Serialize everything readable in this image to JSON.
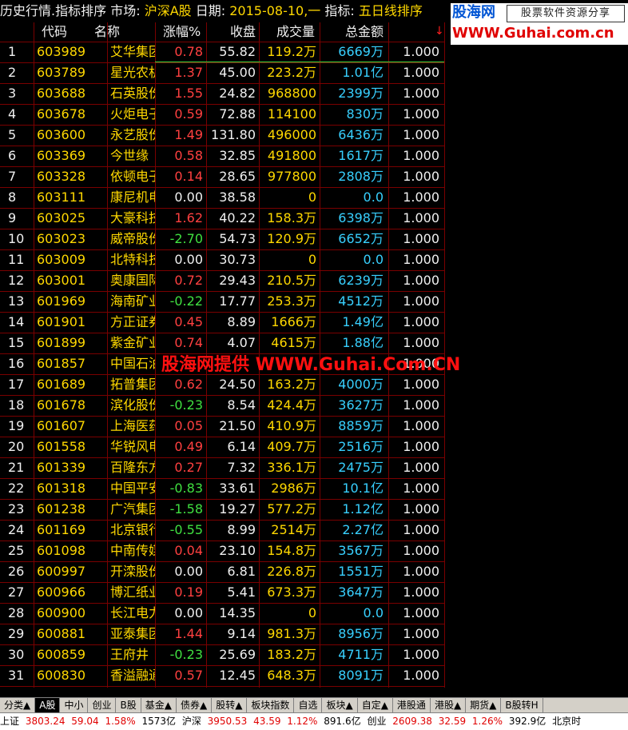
{
  "titlebar": {
    "part1": "历史行情.指标排序",
    "market_label": "市场:",
    "market_value": "沪深A股",
    "date_label": "日期:",
    "date_value": "2015-08-10,一",
    "indicator_label": "指标:",
    "indicator_value": "五日线排序"
  },
  "logo": {
    "brand": "股海网",
    "slogan": "股票软件资源分享",
    "url": "WWW.Guhai.com.cn"
  },
  "table": {
    "headers": [
      "代码",
      "名称",
      "涨幅%",
      "收盘",
      "成交量",
      "总金额"
    ],
    "sort_indicator": "↓",
    "rows": [
      {
        "idx": "1",
        "code": "603989",
        "name": "艾华集团",
        "chg": "0.78",
        "dir": "up",
        "close": "55.82",
        "vol": "119.2万",
        "amt": "6669万",
        "val": "1.000"
      },
      {
        "idx": "2",
        "code": "603789",
        "name": "星光农机",
        "chg": "1.37",
        "dir": "up",
        "close": "45.00",
        "vol": "223.2万",
        "amt": "1.01亿",
        "val": "1.000"
      },
      {
        "idx": "3",
        "code": "603688",
        "name": "石英股份",
        "chg": "1.55",
        "dir": "up",
        "close": "24.82",
        "vol": "968800",
        "amt": "2399万",
        "val": "1.000"
      },
      {
        "idx": "4",
        "code": "603678",
        "name": "火炬电子",
        "chg": "0.59",
        "dir": "up",
        "close": "72.88",
        "vol": "114100",
        "amt": "830万",
        "val": "1.000"
      },
      {
        "idx": "5",
        "code": "603600",
        "name": "永艺股份",
        "chg": "1.49",
        "dir": "up",
        "close": "131.80",
        "vol": "496000",
        "amt": "6436万",
        "val": "1.000"
      },
      {
        "idx": "6",
        "code": "603369",
        "name": "今世缘",
        "chg": "0.58",
        "dir": "up",
        "close": "32.85",
        "vol": "491800",
        "amt": "1617万",
        "val": "1.000"
      },
      {
        "idx": "7",
        "code": "603328",
        "name": "依顿电子",
        "chg": "0.14",
        "dir": "up",
        "close": "28.65",
        "vol": "977800",
        "amt": "2808万",
        "val": "1.000"
      },
      {
        "idx": "8",
        "code": "603111",
        "name": "康尼机电",
        "chg": "0.00",
        "dir": "flat",
        "close": "38.58",
        "vol": "0",
        "amt": "0.0",
        "val": "1.000"
      },
      {
        "idx": "9",
        "code": "603025",
        "name": "大豪科技",
        "chg": "1.62",
        "dir": "up",
        "close": "40.22",
        "vol": "158.3万",
        "amt": "6398万",
        "val": "1.000"
      },
      {
        "idx": "10",
        "code": "603023",
        "name": "威帝股份",
        "chg": "-2.70",
        "dir": "down",
        "close": "54.73",
        "vol": "120.9万",
        "amt": "6652万",
        "val": "1.000"
      },
      {
        "idx": "11",
        "code": "603009",
        "name": "北特科技",
        "chg": "0.00",
        "dir": "flat",
        "close": "30.73",
        "vol": "0",
        "amt": "0.0",
        "val": "1.000"
      },
      {
        "idx": "12",
        "code": "603001",
        "name": "奥康国际",
        "chg": "0.72",
        "dir": "up",
        "close": "29.43",
        "vol": "210.5万",
        "amt": "6239万",
        "val": "1.000"
      },
      {
        "idx": "13",
        "code": "601969",
        "name": "海南矿业",
        "chg": "-0.22",
        "dir": "down",
        "close": "17.77",
        "vol": "253.3万",
        "amt": "4512万",
        "val": "1.000"
      },
      {
        "idx": "14",
        "code": "601901",
        "name": "方正证券",
        "chg": "0.45",
        "dir": "up",
        "close": "8.89",
        "vol": "1666万",
        "amt": "1.49亿",
        "val": "1.000"
      },
      {
        "idx": "15",
        "code": "601899",
        "name": "紫金矿业",
        "chg": "0.74",
        "dir": "up",
        "close": "4.07",
        "vol": "4615万",
        "amt": "1.88亿",
        "val": "1.000"
      },
      {
        "idx": "16",
        "code": "601857",
        "name": "中国石油",
        "chg": "",
        "dir": "flat",
        "close": "",
        "vol": "",
        "amt": "",
        "val": "1.000"
      },
      {
        "idx": "17",
        "code": "601689",
        "name": "拓普集团",
        "chg": "0.62",
        "dir": "up",
        "close": "24.50",
        "vol": "163.2万",
        "amt": "4000万",
        "val": "1.000"
      },
      {
        "idx": "18",
        "code": "601678",
        "name": "滨化股份",
        "chg": "-0.23",
        "dir": "down",
        "close": "8.54",
        "vol": "424.4万",
        "amt": "3627万",
        "val": "1.000"
      },
      {
        "idx": "19",
        "code": "601607",
        "name": "上海医药",
        "chg": "0.05",
        "dir": "up",
        "close": "21.50",
        "vol": "410.9万",
        "amt": "8859万",
        "val": "1.000"
      },
      {
        "idx": "20",
        "code": "601558",
        "name": "华锐风电",
        "chg": "0.49",
        "dir": "up",
        "close": "6.14",
        "vol": "409.7万",
        "amt": "2516万",
        "val": "1.000"
      },
      {
        "idx": "21",
        "code": "601339",
        "name": "百隆东方",
        "chg": "0.27",
        "dir": "up",
        "close": "7.32",
        "vol": "336.1万",
        "amt": "2475万",
        "val": "1.000"
      },
      {
        "idx": "22",
        "code": "601318",
        "name": "中国平安",
        "chg": "-0.83",
        "dir": "down",
        "close": "33.61",
        "vol": "2986万",
        "amt": "10.1亿",
        "val": "1.000"
      },
      {
        "idx": "23",
        "code": "601238",
        "name": "广汽集团",
        "chg": "-1.58",
        "dir": "down",
        "close": "19.27",
        "vol": "577.2万",
        "amt": "1.12亿",
        "val": "1.000"
      },
      {
        "idx": "24",
        "code": "601169",
        "name": "北京银行",
        "chg": "-0.55",
        "dir": "down",
        "close": "8.99",
        "vol": "2514万",
        "amt": "2.27亿",
        "val": "1.000"
      },
      {
        "idx": "25",
        "code": "601098",
        "name": "中南传媒",
        "chg": "0.04",
        "dir": "up",
        "close": "23.10",
        "vol": "154.8万",
        "amt": "3567万",
        "val": "1.000"
      },
      {
        "idx": "26",
        "code": "600997",
        "name": "开滦股份",
        "chg": "0.00",
        "dir": "flat",
        "close": "6.81",
        "vol": "226.8万",
        "amt": "1551万",
        "val": "1.000"
      },
      {
        "idx": "27",
        "code": "600966",
        "name": "博汇纸业",
        "chg": "0.19",
        "dir": "up",
        "close": "5.41",
        "vol": "673.3万",
        "amt": "3647万",
        "val": "1.000"
      },
      {
        "idx": "28",
        "code": "600900",
        "name": "长江电力",
        "chg": "0.00",
        "dir": "flat",
        "close": "14.35",
        "vol": "0",
        "amt": "0.0",
        "val": "1.000"
      },
      {
        "idx": "29",
        "code": "600881",
        "name": "亚泰集团",
        "chg": "1.44",
        "dir": "up",
        "close": "9.14",
        "vol": "981.3万",
        "amt": "8956万",
        "val": "1.000"
      },
      {
        "idx": "30",
        "code": "600859",
        "name": "王府井",
        "chg": "-0.23",
        "dir": "down",
        "close": "25.69",
        "vol": "183.2万",
        "amt": "4711万",
        "val": "1.000"
      },
      {
        "idx": "31",
        "code": "600830",
        "name": "香溢融通",
        "chg": "0.57",
        "dir": "up",
        "close": "12.45",
        "vol": "648.3万",
        "amt": "8091万",
        "val": "1.000"
      }
    ]
  },
  "watermark": "股海网提供 WWW.Guhai.Com.CN",
  "tabs": [
    {
      "label": "分类▲",
      "active": false
    },
    {
      "label": "A股",
      "active": true
    },
    {
      "label": "中小",
      "active": false
    },
    {
      "label": "创业",
      "active": false
    },
    {
      "label": "B股",
      "active": false
    },
    {
      "label": "基金▲",
      "active": false
    },
    {
      "label": "债券▲",
      "active": false
    },
    {
      "label": "股转▲",
      "active": false
    },
    {
      "label": "板块指数",
      "active": false
    },
    {
      "label": "自选",
      "active": false
    },
    {
      "label": "板块▲",
      "active": false
    },
    {
      "label": "自定▲",
      "active": false
    },
    {
      "label": "港股通",
      "active": false
    },
    {
      "label": "港股▲",
      "active": false
    },
    {
      "label": "期货▲",
      "active": false
    },
    {
      "label": "B股转H",
      "active": false
    }
  ],
  "statusbar": {
    "sh_name": "上证",
    "sh_index": "3803.24",
    "sh_change": "59.04",
    "sh_pct": "1.58%",
    "sh_amount": "1573亿",
    "hs_name": "沪深",
    "hs_index": "3950.53",
    "hs_change": "43.59",
    "hs_pct": "1.12%",
    "hs_amount": "891.6亿",
    "cy_name": "创业",
    "cy_index": "2609.38",
    "cy_change": "32.59",
    "cy_pct": "1.26%",
    "cy_amount": "392.9亿",
    "tail": "北京时"
  }
}
